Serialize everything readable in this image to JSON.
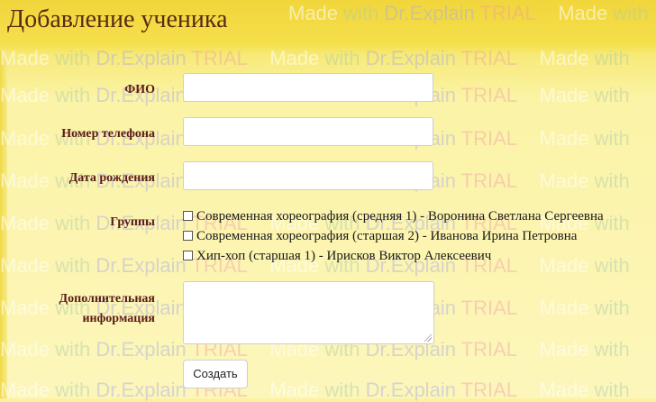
{
  "page": {
    "title": "Добавление ученика",
    "watermark": {
      "made": "Made",
      "with": "with",
      "dr": "Dr.Explain",
      "trial": "TRIAL"
    }
  },
  "form": {
    "fio_label": "ФИО",
    "phone_label": "Номер телефона",
    "birth_label": "Дата рождения",
    "groups_label": "Группы",
    "extra_label_line1": "Дополнительная",
    "extra_label_line2": "информация",
    "fio_value": "",
    "phone_value": "",
    "birth_value": "",
    "extra_value": "",
    "groups": [
      {
        "label": "Современная хореография (средняя 1) - Воронина Светлана Сергеевна",
        "checked": false
      },
      {
        "label": "Современная хореография (старшая 2) - Иванова Ирина Петровна",
        "checked": false
      },
      {
        "label": "Хип-хоп (старшая 1) - Ирисков Виктор Алексеевич",
        "checked": false
      }
    ],
    "submit_label": "Создать"
  }
}
